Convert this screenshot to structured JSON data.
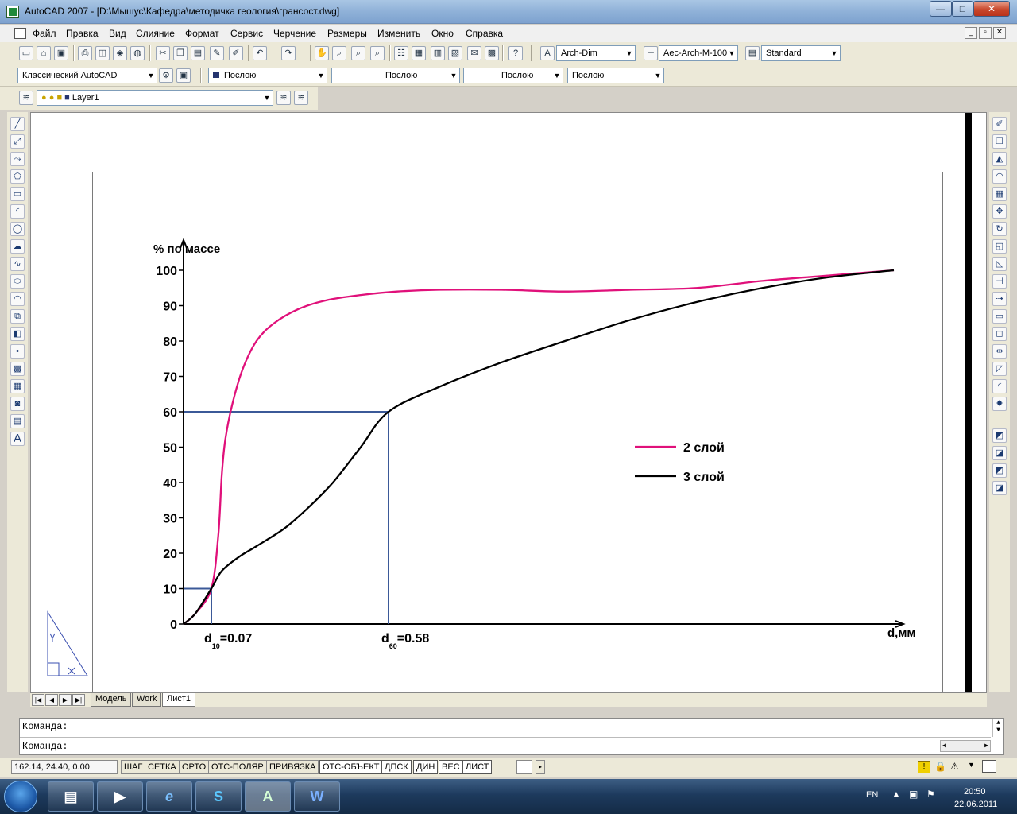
{
  "window": {
    "title": "AutoCAD 2007 - [D:\\Мышус\\Кафедра\\методичка геология\\грансост.dwg]",
    "min_glyph": "—",
    "max_glyph": "□",
    "close_glyph": "✕"
  },
  "menu": [
    "Файл",
    "Правка",
    "Вид",
    "Слияние",
    "Формат",
    "Сервис",
    "Черчение",
    "Размеры",
    "Изменить",
    "Окно",
    "Справка"
  ],
  "mdi_controls": [
    "_",
    "▫",
    "✕"
  ],
  "toolbar_standard": {
    "text_style": "Arch-Dim",
    "dim_style": "Aec-Arch-M-100",
    "table_style": "Standard"
  },
  "toolbar_workspace": {
    "workspace": "Классический AutoCAD",
    "color": "Послою",
    "linetype": "Послою",
    "lineweight": "Послою",
    "plotstyle": "Послою"
  },
  "toolbar_layers": {
    "layer": "Layer1"
  },
  "chart_data": {
    "type": "line",
    "ylabel": "% по массе",
    "xlabel": "d,мм",
    "y_ticks": [
      "0",
      "10",
      "20",
      "30",
      "40",
      "50",
      "60",
      "70",
      "80",
      "90",
      "100"
    ],
    "ylim": [
      0,
      100
    ],
    "xlim": [
      0,
      2
    ],
    "series": [
      {
        "name": "2 слой",
        "color": "#e0107a",
        "points": [
          [
            0,
            0
          ],
          [
            0.03,
            3
          ],
          [
            0.07,
            10
          ],
          [
            0.09,
            25
          ],
          [
            0.1,
            42
          ],
          [
            0.11,
            52
          ],
          [
            0.13,
            62
          ],
          [
            0.16,
            72
          ],
          [
            0.2,
            80
          ],
          [
            0.25,
            85
          ],
          [
            0.32,
            89
          ],
          [
            0.4,
            91.5
          ],
          [
            0.5,
            93
          ],
          [
            0.6,
            94
          ],
          [
            0.7,
            94.5
          ],
          [
            0.85,
            94.5
          ],
          [
            1.0,
            94
          ],
          [
            1.2,
            94.5
          ],
          [
            1.4,
            95
          ],
          [
            1.6,
            97
          ],
          [
            1.8,
            98.5
          ],
          [
            2.0,
            100
          ]
        ]
      },
      {
        "name": "3 слой",
        "color": "#000000",
        "points": [
          [
            0,
            0
          ],
          [
            0.03,
            3
          ],
          [
            0.07,
            10
          ],
          [
            0.1,
            15
          ],
          [
            0.15,
            19
          ],
          [
            0.2,
            22
          ],
          [
            0.28,
            27
          ],
          [
            0.35,
            33
          ],
          [
            0.42,
            40
          ],
          [
            0.5,
            50
          ],
          [
            0.58,
            60
          ],
          [
            0.7,
            67
          ],
          [
            0.85,
            74
          ],
          [
            1.0,
            80
          ],
          [
            1.2,
            86
          ],
          [
            1.4,
            91
          ],
          [
            1.6,
            95
          ],
          [
            1.8,
            98
          ],
          [
            2.0,
            100
          ]
        ]
      }
    ],
    "guides": [
      {
        "x": 0.07,
        "y": 10,
        "label_main": "d",
        "label_sub": "10",
        "label_value": "=0.07"
      },
      {
        "x": 0.58,
        "y": 60,
        "label_main": "d",
        "label_sub": "60",
        "label_value": "=0.58"
      }
    ],
    "grid": false,
    "legend": "right"
  },
  "tabs": [
    "Модель",
    "Work",
    "Лист1"
  ],
  "active_tab": "Лист1",
  "command": {
    "line1": "Команда:",
    "line2": "Команда:"
  },
  "status": {
    "coords": "162.14, 24.40, 0.00",
    "buttons": [
      "ШАГ",
      "СЕТКА",
      "ОРТО",
      "ОТС-ПОЛЯР",
      "ПРИВЯЗКА",
      "ОТС-ОБЪЕКТ",
      "ДПСК",
      "ДИН",
      "ВЕС",
      "ЛИСТ"
    ],
    "active_buttons": [
      "ОТС-ОБЪЕКТ",
      "ДПСК",
      "ДИН",
      "ВЕС",
      "ЛИСТ"
    ]
  },
  "taskbar": {
    "lang": "EN",
    "time": "20:50",
    "date": "22.06.2011"
  }
}
